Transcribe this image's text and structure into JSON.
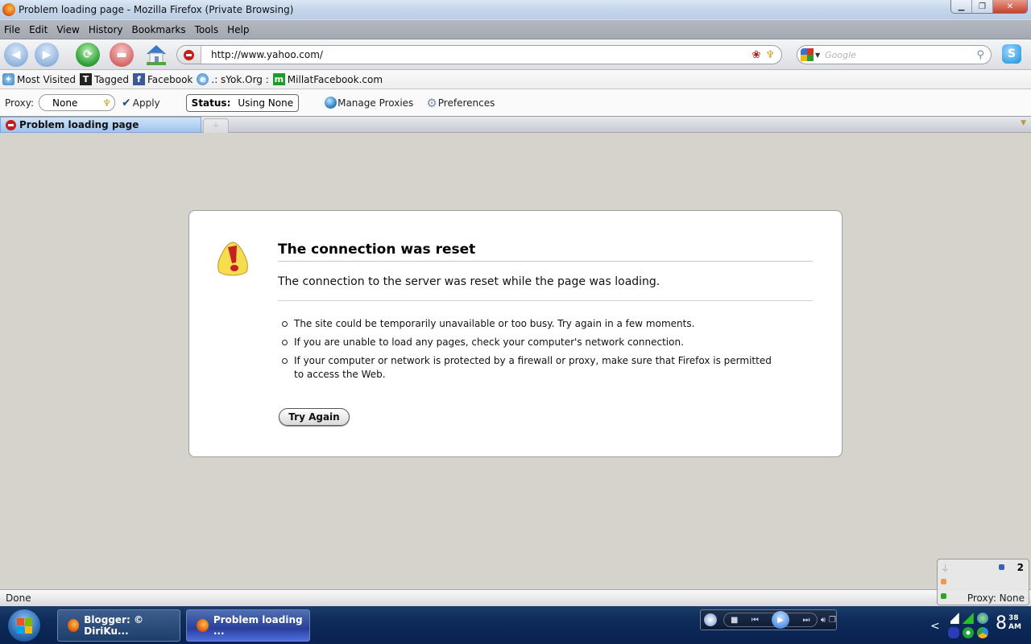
{
  "window": {
    "title": "Problem loading page - Mozilla Firefox (Private Browsing)",
    "controls": [
      "minimize",
      "restore",
      "close"
    ]
  },
  "menu": {
    "items": [
      {
        "label": "File",
        "accel": "F"
      },
      {
        "label": "Edit",
        "accel": "E"
      },
      {
        "label": "View",
        "accel": "V"
      },
      {
        "label": "History",
        "accel": "s"
      },
      {
        "label": "Bookmarks",
        "accel": "B"
      },
      {
        "label": "Tools",
        "accel": "T"
      },
      {
        "label": "Help",
        "accel": "H"
      }
    ]
  },
  "navigation": {
    "url": "http://www.yahoo.com/",
    "search_placeholder": "Google",
    "back_icon": "back-arrow-icon",
    "forward_icon": "forward-arrow-icon",
    "reload_icon": "reload-icon",
    "stop_icon": "stop-icon",
    "home_icon": "home-icon"
  },
  "bookmarks": {
    "items": [
      {
        "label": "Most Visited",
        "icon": "most-visited-icon",
        "glyph": "✦"
      },
      {
        "label": "Tagged",
        "icon": "tagged-icon",
        "glyph": "T"
      },
      {
        "label": "Facebook",
        "icon": "facebook-icon",
        "glyph": "f"
      },
      {
        "label": ".: sYok.Org :",
        "icon": "ie-icon",
        "glyph": "e"
      },
      {
        "label": "MillatFacebook.com",
        "icon": "millat-icon",
        "glyph": "m"
      }
    ]
  },
  "proxy_toolbar": {
    "proxy_label": "Proxy:",
    "proxy_value": "None",
    "apply_label": "Apply",
    "status_label": "Status:",
    "status_value": "Using None",
    "manage_label": "Manage Proxies",
    "preferences_label": "Preferences"
  },
  "tabs": [
    {
      "title": "Problem loading page",
      "active": true
    }
  ],
  "new_tab_label": "+",
  "error_page": {
    "title": "The connection was reset",
    "description": "The connection to the server was reset while the page was loading.",
    "suggestions": [
      "The site could be temporarily unavailable or too busy. Try again in a few moments.",
      "If you are unable to load any pages, check your computer's network connection.",
      "If your computer or network is protected by a firewall or proxy, make sure that Firefox is permitted to access the Web."
    ],
    "try_again_label": "Try Again"
  },
  "statusbar": {
    "text": "Done",
    "popup_count": "2",
    "proxy_status": "Proxy: None"
  },
  "taskbar": {
    "tasks": [
      {
        "label": "Blogger: © DiriKu..."
      },
      {
        "label": "Problem loading ..."
      }
    ],
    "clock": {
      "hour": "8",
      "minutes": "38",
      "ampm": "AM"
    },
    "tray_expand": "<"
  }
}
